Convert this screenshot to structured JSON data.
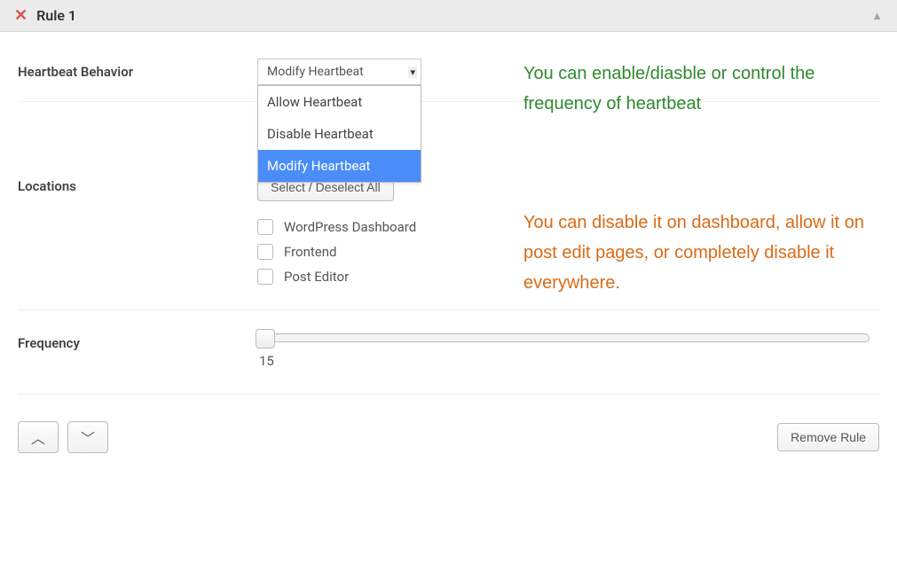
{
  "header": {
    "title": "Rule 1"
  },
  "behavior": {
    "label": "Heartbeat Behavior",
    "selected": "Modify Heartbeat",
    "options": {
      "allow": "Allow Heartbeat",
      "disable": "Disable Heartbeat",
      "modify": "Modify Heartbeat"
    }
  },
  "locations": {
    "label": "Locations",
    "select_all_btn": "Select / Deselect All",
    "items": {
      "dashboard": "WordPress Dashboard",
      "frontend": "Frontend",
      "post_editor": "Post Editor"
    }
  },
  "frequency": {
    "label": "Frequency",
    "value": "15"
  },
  "annotations": {
    "top": "You can enable/diasble or control the frequency of heartbeat",
    "middle": "You can disable it on dashboard, allow it on post edit pages, or completely disable it everywhere."
  },
  "footer": {
    "remove_btn": "Remove Rule"
  }
}
